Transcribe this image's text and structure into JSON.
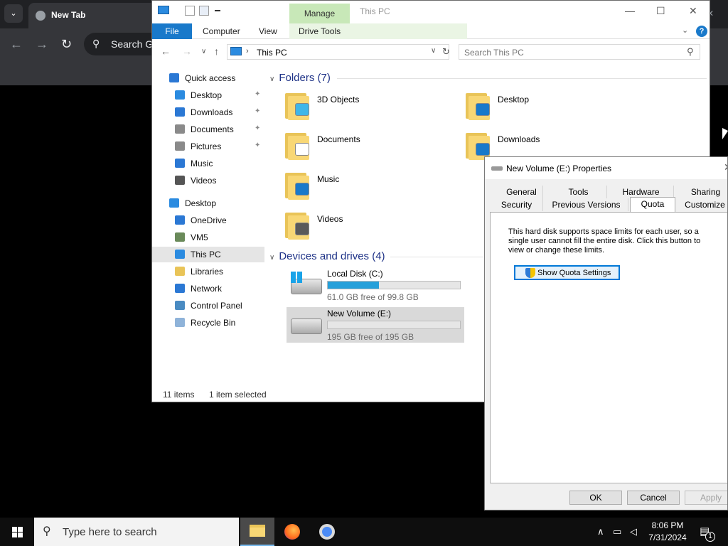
{
  "chrome": {
    "tab_title": "New Tab",
    "omnibox_text": "Search Google or type a URL",
    "dropdown_glyph": "⌄",
    "close_glyph": "✕",
    "kebab_glyph": "⋮"
  },
  "explorer": {
    "title": "This PC",
    "manage_tab": "Manage",
    "ribbon_tabs": [
      "File",
      "Computer",
      "View",
      "Drive Tools"
    ],
    "help_glyph": "?",
    "address_crumb": "This PC",
    "search_placeholder": "Search This PC",
    "nav_items": [
      {
        "label": "Quick access",
        "icon": "star-icon"
      },
      {
        "label": "Desktop",
        "icon": "desktop-icon",
        "pinned": true
      },
      {
        "label": "Downloads",
        "icon": "download-arrow-icon",
        "pinned": true
      },
      {
        "label": "Documents",
        "icon": "documents-icon",
        "pinned": true
      },
      {
        "label": "Pictures",
        "icon": "pictures-icon",
        "pinned": true
      },
      {
        "label": "Music",
        "icon": "music-note-icon"
      },
      {
        "label": "Videos",
        "icon": "film-icon"
      },
      {
        "label": "Desktop",
        "icon": "desktop-icon"
      },
      {
        "label": "OneDrive",
        "icon": "cloud-icon"
      },
      {
        "label": "VM5",
        "icon": "user-icon"
      },
      {
        "label": "This PC",
        "icon": "pc-icon",
        "selected": true
      },
      {
        "label": "Libraries",
        "icon": "libraries-icon"
      },
      {
        "label": "Network",
        "icon": "network-icon"
      },
      {
        "label": "Control Panel",
        "icon": "control-panel-icon"
      },
      {
        "label": "Recycle Bin",
        "icon": "recycle-bin-icon"
      }
    ],
    "folders_header": "Folders (7)",
    "folders": [
      {
        "name": "3D Objects",
        "badge_color": "#3fb6e8"
      },
      {
        "name": "Desktop",
        "badge_color": "#1979ca"
      },
      {
        "name": "Documents",
        "badge_color": "#ffffff"
      },
      {
        "name": "Downloads",
        "badge_color": "#1979ca"
      },
      {
        "name": "Music",
        "badge_color": "#1979ca"
      },
      {
        "name": "Videos",
        "badge_color": "#5a5a5a"
      }
    ],
    "drives_header": "Devices and drives (4)",
    "drives": [
      {
        "name": "Local Disk (C:)",
        "free_text": "61.0 GB free of 99.8 GB",
        "used_fraction": 0.389,
        "has_windows_logo": true
      },
      {
        "name": "New Volume (E:)",
        "free_text": "195 GB free of 195 GB",
        "used_fraction": 0.0,
        "selected": true
      }
    ],
    "status_items": "11 items",
    "status_selected": "1 item selected"
  },
  "properties": {
    "title": "New Volume (E:) Properties",
    "tabs_row1": [
      "General",
      "Tools",
      "Hardware",
      "Sharing"
    ],
    "tabs_row2": [
      "Security",
      "Previous Versions",
      "Quota",
      "Customize"
    ],
    "active_tab": "Quota",
    "description": "This hard disk supports space limits for each user, so a single user cannot fill the entire disk. Click this button to view or change these limits.",
    "quota_button": "Show Quota Settings",
    "ok": "OK",
    "cancel": "Cancel",
    "apply": "Apply"
  },
  "taskbar": {
    "search_placeholder": "Type here to search",
    "time": "8:06 PM",
    "date": "7/31/2024",
    "notification_count": "1"
  },
  "colors": {
    "accent": "#1979ca",
    "drive_fill": "#26a0da",
    "manage_tab": "#c8e8b8",
    "folder_header": "#1e3287"
  }
}
